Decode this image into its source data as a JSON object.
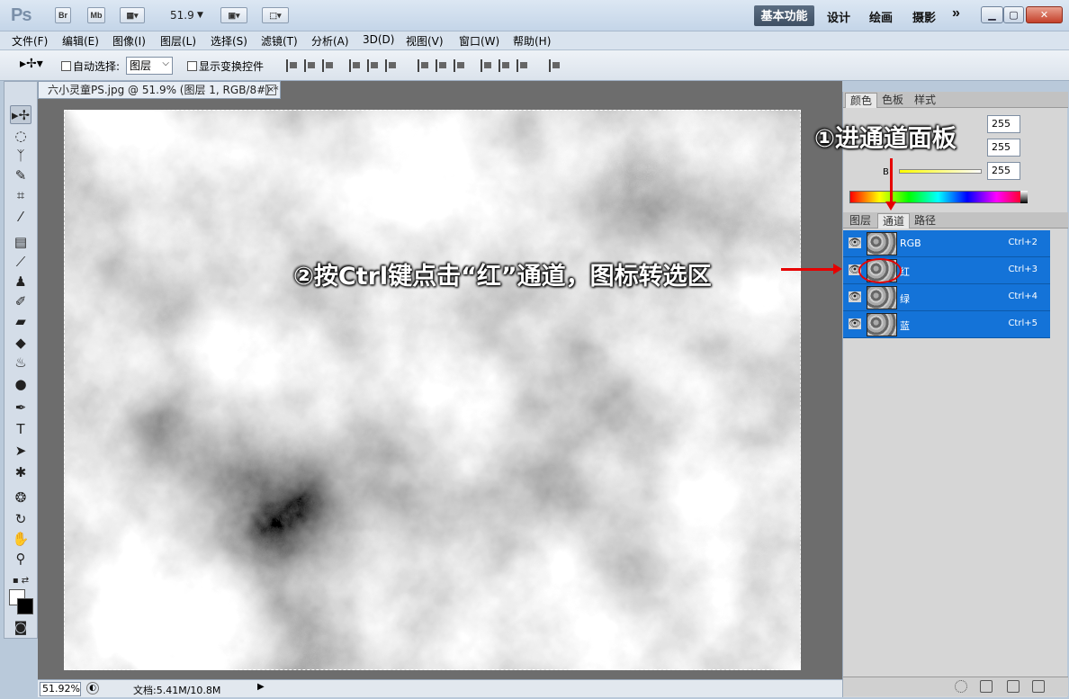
{
  "title_bar": {
    "app_logo": "Ps",
    "br": "Br",
    "mb": "Mb",
    "zoom": "51.9",
    "workspaces": [
      "基本功能",
      "设计",
      "绘画",
      "摄影"
    ],
    "more": "»"
  },
  "menu": [
    "文件(F)",
    "编辑(E)",
    "图像(I)",
    "图层(L)",
    "选择(S)",
    "滤镜(T)",
    "分析(A)",
    "3D(D)",
    "视图(V)",
    "窗口(W)",
    "帮助(H)"
  ],
  "options": {
    "auto_select": "自动选择:",
    "layer_select": "图层",
    "show_transform": "显示变换控件"
  },
  "document": {
    "tab_title": "六小灵童PS.jpg @ 51.9% (图层 1, RGB/8#) *",
    "close": "×"
  },
  "status": {
    "zoom": "51.92%",
    "doc_size": "文档:5.41M/10.8M"
  },
  "color_panel": {
    "tabs": [
      "颜色",
      "色板",
      "样式"
    ],
    "values": [
      "255",
      "255",
      "255"
    ],
    "b_label": "B"
  },
  "layers_panel": {
    "tabs": [
      "图层",
      "通道",
      "路径"
    ],
    "channels": [
      {
        "name": "RGB",
        "shortcut": "Ctrl+2"
      },
      {
        "name": "红",
        "shortcut": "Ctrl+3"
      },
      {
        "name": "绿",
        "shortcut": "Ctrl+4"
      },
      {
        "name": "蓝",
        "shortcut": "Ctrl+5"
      }
    ]
  },
  "annotations": {
    "step1": "①进通道面板",
    "step2": "②按Ctrl键点击“红”通道，图标转选区"
  },
  "colors": {
    "channel_highlight": "#1473d8",
    "annotation_red": "#e60000"
  }
}
